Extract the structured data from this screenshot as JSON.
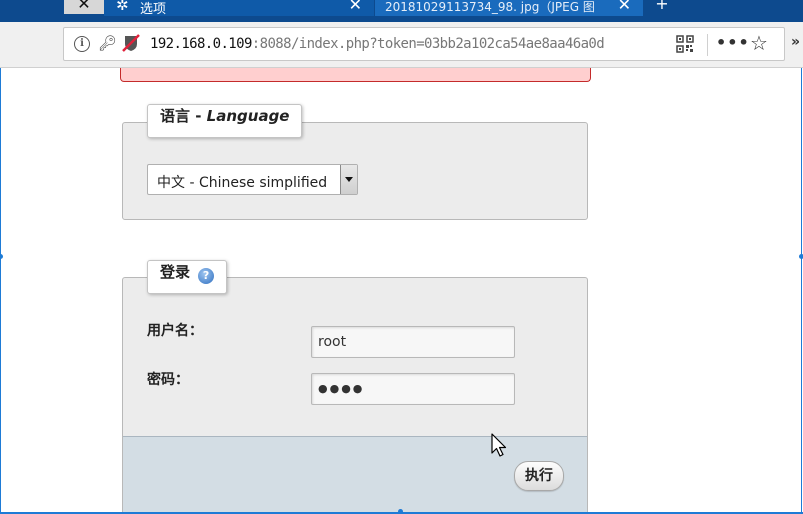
{
  "browser": {
    "tabs": [
      {
        "label": "选项",
        "active": true
      },
      {
        "label": "20181029113734_98. jpg（JPEG 图"
      }
    ],
    "close_glyph": "✕",
    "new_tab_glyph": "+",
    "address": {
      "host": "192.168.0.109",
      "port": ":8088",
      "path": "/index.php?token=03bb2a102ca54ae8aa46a0d"
    },
    "more_glyph": "•••",
    "bookmark_glyph": "☆",
    "overflow_glyph": "»"
  },
  "language_section": {
    "legend_prefix": "语言 - ",
    "legend_italic": "Language",
    "selected_option": "中文 - Chinese simplified"
  },
  "login_section": {
    "legend": "登录",
    "help_glyph": "?",
    "username_label": "用户名：",
    "username_value": "root",
    "password_label": "密码：",
    "password_mask": "●●●●",
    "submit_label": "执行"
  },
  "colors": {
    "tab_strip": "#0d4a8e",
    "error_bg": "#ffcfcf",
    "error_border": "#c42b2b",
    "footer_bg": "#d3dde4",
    "frame": "#1e7bd6"
  },
  "icons": [
    "close-icon",
    "settings-icon",
    "info-icon",
    "key-icon",
    "insecure-shield-icon",
    "qr-code-icon",
    "more-icon",
    "bookmark-star-icon",
    "help-icon",
    "dropdown-arrow-icon",
    "mouse-cursor-icon"
  ]
}
